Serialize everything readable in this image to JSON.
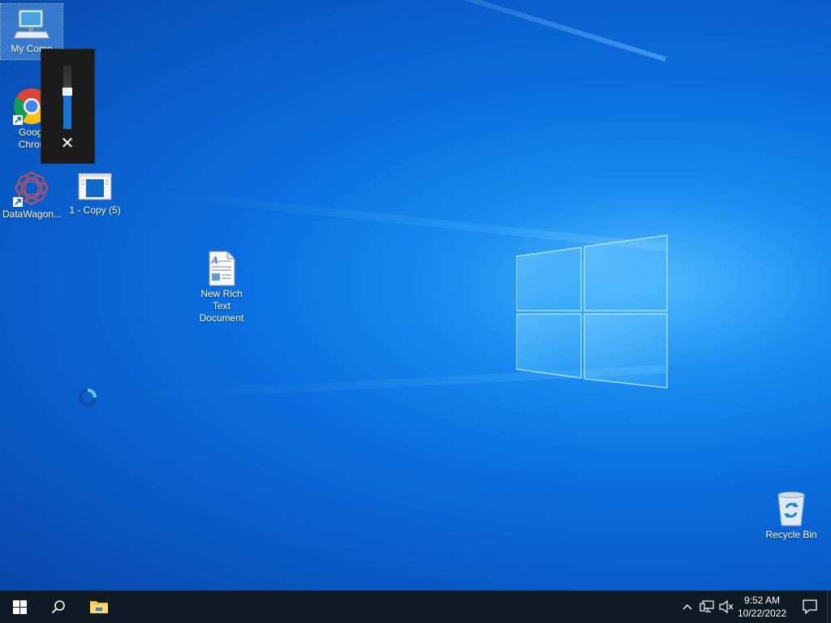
{
  "desktop": {
    "icons": [
      {
        "label": "My Comp",
        "icon": "computer-icon"
      },
      {
        "label": "Google Chrome",
        "line1": "Googl",
        "line2": "Chron",
        "icon": "chrome-icon"
      },
      {
        "label": "DataWagon...",
        "icon": "datawagon-icon"
      },
      {
        "label": "1 - Copy (5)",
        "icon": "document-window-icon"
      },
      {
        "label": "New Rich Text Document",
        "line1": "New Rich Text",
        "line2": "Document",
        "icon": "rich-text-document-icon"
      },
      {
        "label": "Recycle Bin",
        "icon": "recycle-bin-icon"
      }
    ]
  },
  "volume_flyout": {
    "level_fraction": 0.55,
    "close_glyph": "✕"
  },
  "taskbar": {
    "start_icon": "windows-start-icon",
    "search_icon": "search-icon",
    "pinned": [
      {
        "name": "File Explorer",
        "icon": "folder-icon"
      }
    ],
    "tray": {
      "chevron_glyph": "^",
      "network_icon": "network-icon",
      "volume_icon": "volume-muted-icon"
    },
    "clock": {
      "time": "9:52 AM",
      "date": "10/22/2022"
    },
    "notification_icon": "notification-icon"
  },
  "colors": {
    "accent": "#1a74d8",
    "taskbar": "#0f1a24",
    "flyout": "#1b1b1b"
  }
}
